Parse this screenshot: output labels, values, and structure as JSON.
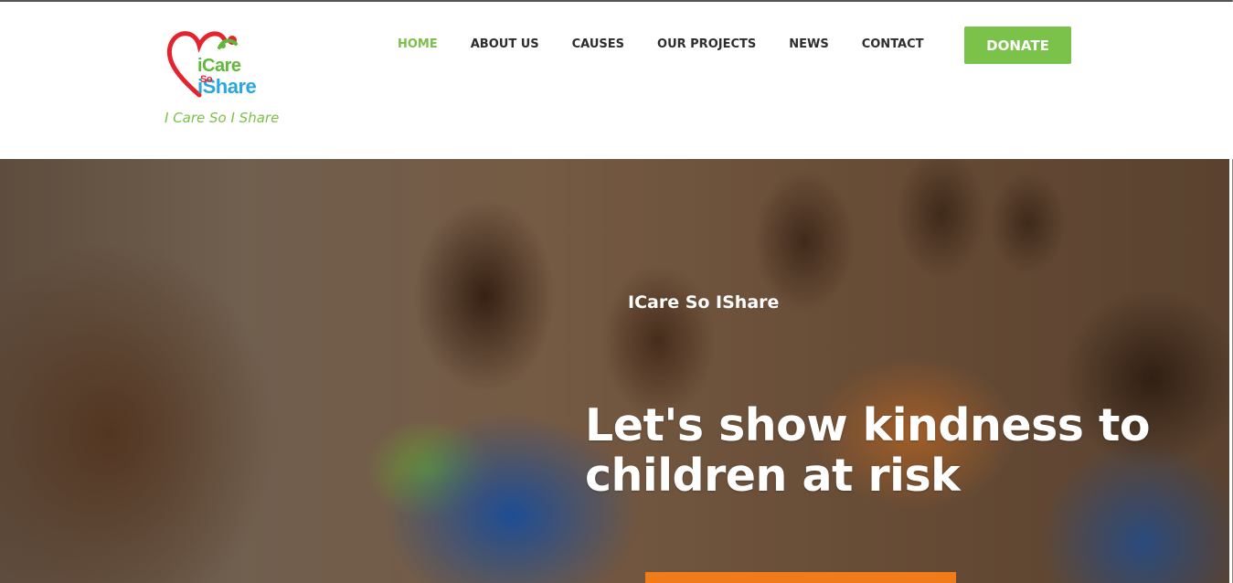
{
  "brand": {
    "logo_line1": "iCare",
    "logo_line2": "So",
    "logo_line3": "iShare",
    "tagline": "I Care So I Share",
    "colors": {
      "green": "#7bbf4a",
      "red": "#e5232d",
      "blue": "#29a7e1"
    }
  },
  "nav": {
    "items": [
      {
        "label": "HOME",
        "active": true
      },
      {
        "label": "ABOUT US",
        "active": false
      },
      {
        "label": "CAUSES",
        "active": false
      },
      {
        "label": "OUR PROJECTS",
        "active": false
      },
      {
        "label": "NEWS",
        "active": false
      },
      {
        "label": "CONTACT",
        "active": false
      }
    ],
    "donate_label": "DONATE"
  },
  "hero": {
    "kicker": "ICare So IShare",
    "title": "Let's show kindness to children at risk",
    "cta_color": "#f07b19"
  }
}
